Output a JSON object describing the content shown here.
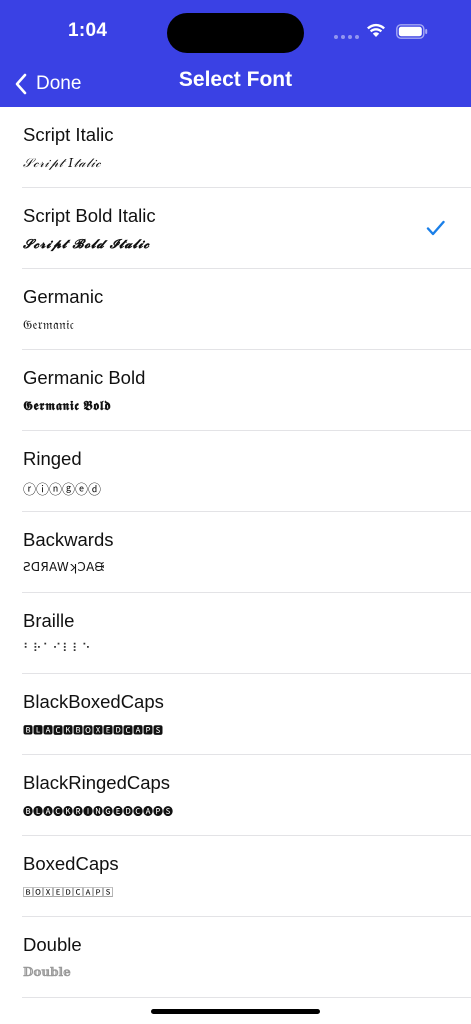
{
  "status_bar": {
    "time": "1:04"
  },
  "nav": {
    "back_label": "Done",
    "title": "Select Font"
  },
  "colors": {
    "header": "#3a41e4",
    "checkmark": "#1a7fe8",
    "separator": "#e3e3e6"
  },
  "fonts": [
    {
      "name": "Script Italic",
      "sample": "𝒮𝒸𝓇𝒾𝓅𝓉 𝐼𝓉𝒶𝓁𝒾𝒸",
      "selected": false
    },
    {
      "name": "Script Bold Italic",
      "sample": "𝓢𝓬𝓻𝓲𝓹𝓽 𝓑𝓸𝓵𝓭 𝓘𝓽𝓪𝓵𝓲𝓬",
      "selected": true
    },
    {
      "name": "Germanic",
      "sample": "𝔊𝔢𝔯𝔪𝔞𝔫𝔦𝔠",
      "selected": false
    },
    {
      "name": "Germanic Bold",
      "sample": "𝕲𝖊𝖗𝖒𝖆𝖓𝖎𝖈 𝕭𝖔𝖑𝖉",
      "selected": false
    },
    {
      "name": "Ringed",
      "sample": "ⓡⓘⓝⓖⓔⓓ",
      "selected": false
    },
    {
      "name": "Backwards",
      "sample": "ƧᗡЯAWʞƆAᙠ",
      "selected": false
    },
    {
      "name": "Braille",
      "sample": "⠃⠗⠁⠊⠇⠇⠑",
      "selected": false
    },
    {
      "name": "BlackBoxedCaps",
      "sample": "🅱🅻🅰🅲🅺🅱🅾🆇🅴🅳🅲🅰🅿🆂",
      "selected": false
    },
    {
      "name": "BlackRingedCaps",
      "sample": "🅑🅛🅐🅒🅚🅡🅘🅝🅖🅔🅓🅒🅐🅟🅢",
      "selected": false
    },
    {
      "name": "BoxedCaps",
      "sample": "🄱🄾🅇🄴🄳🄲🄰🄿🅂",
      "selected": false
    },
    {
      "name": "Double",
      "sample": "𝔻𝕠𝕦𝕓𝕝𝕖",
      "selected": false
    }
  ]
}
